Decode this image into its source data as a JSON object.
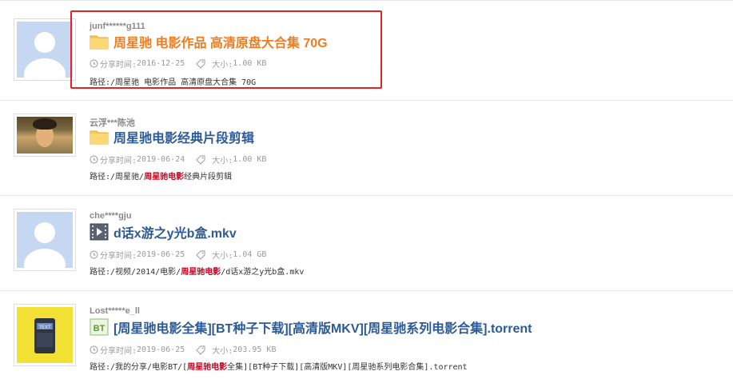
{
  "results": [
    {
      "user": "junf******g111",
      "title": "周星驰 电影作品 高清原盘大合集 70G",
      "type": "folder",
      "share_label": "分享时间:",
      "share_time": "2016-12-25",
      "size_label": "大小:",
      "size": "1.00 KB",
      "path_label": "路径:",
      "path_pre": "/周星驰 电影作品 高清原盘大合集 70G",
      "path_hl": "",
      "path_post": "",
      "avatar": "default-avatar",
      "selected": true
    },
    {
      "user": "云浮***陈池",
      "title": "周星驰电影经典片段剪辑",
      "type": "folder",
      "share_label": "分享时间:",
      "share_time": "2019-06-24",
      "size_label": "大小:",
      "size": "1.00 KB",
      "path_label": "路径:",
      "path_pre": "/周星驰/",
      "path_hl": "周星驰电影",
      "path_post": "经典片段剪辑",
      "avatar": "photo-avatar"
    },
    {
      "user": "che****gju",
      "title": "d话x游之y光b盒.mkv",
      "type": "video",
      "share_label": "分享时间:",
      "share_time": "2019-06-25",
      "size_label": "大小:",
      "size": "1.04 GB",
      "path_label": "路径:",
      "path_pre": "/视频/2014/电影/",
      "path_hl": "周星驰电影",
      "path_post": "/d话x游之y光b盒.mkv",
      "avatar": "default-avatar"
    },
    {
      "user": "Lost*****e_ll",
      "title": "[周星驰电影全集][BT种子下载][高清版MKV][周星驰系列电影合集].torrent",
      "type": "torrent",
      "type_badge": "BT",
      "share_label": "分享时间:",
      "share_time": "2019-06-25",
      "size_label": "大小:",
      "size": "203.95 KB",
      "path_label": "路径:",
      "path_pre": "/我的分享/电影BT/[",
      "path_hl": "周星驰电影",
      "path_post": "全集][BT种子下载][高清版MKV][周星驰系列电影合集].torrent",
      "avatar": "yellow-avatar"
    }
  ],
  "colors": {
    "title_link": "#2c5a96",
    "title_selected": "#ef7d1e",
    "keyword_highlight": "#d7001e",
    "selection_border": "#e12424"
  },
  "icons": {
    "folder": "folder-icon",
    "video": "video-file-icon",
    "torrent": "bt-torrent-icon",
    "time": "clock-icon",
    "size": "tag-icon"
  }
}
